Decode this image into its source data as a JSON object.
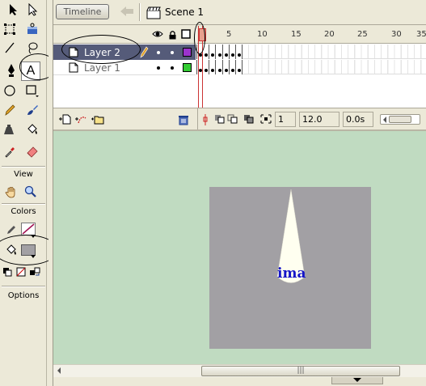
{
  "tools_panel": {
    "tools": [
      {
        "name": "arrow-tool-icon"
      },
      {
        "name": "subselect-tool-icon"
      },
      {
        "name": "free-transform-tool-icon"
      },
      {
        "name": "fill-transform-tool-icon"
      },
      {
        "name": "line-tool-icon"
      },
      {
        "name": "lasso-tool-icon"
      },
      {
        "name": "pen-tool-icon"
      },
      {
        "name": "text-tool-icon",
        "glyph": "A",
        "selected": true
      },
      {
        "name": "oval-tool-icon"
      },
      {
        "name": "rectangle-tool-icon"
      },
      {
        "name": "pencil-tool-icon"
      },
      {
        "name": "brush-tool-icon"
      },
      {
        "name": "ink-bottle-tool-icon"
      },
      {
        "name": "paint-bucket-tool-icon"
      },
      {
        "name": "eyedropper-tool-icon"
      },
      {
        "name": "eraser-tool-icon"
      }
    ],
    "view_label": "View",
    "colors_label": "Colors",
    "options_label": "Options",
    "stroke_color": "#A01050",
    "fill_color": "#A2A0A4"
  },
  "topbar": {
    "timeline_button": "Timeline",
    "scene_label": "Scene 1"
  },
  "timeline": {
    "ruler_numbers": [
      "1",
      "5",
      "10",
      "15",
      "20",
      "25",
      "30",
      "35"
    ],
    "layers": [
      {
        "label": "Layer 2",
        "selected": true,
        "color": "#9B33CC"
      },
      {
        "label": "Layer 1",
        "selected": false,
        "color": "#33CC33"
      }
    ],
    "footer": {
      "current_frame": "1",
      "frame_rate": "12.0 fps",
      "elapsed_time": "0.0s"
    }
  },
  "stage": {
    "text": "ima",
    "background": "#A2A0A4",
    "work_area": "#C0DBC1",
    "text_color": "#1515C8"
  },
  "scrollbar": {
    "thumb_grip": "|||"
  }
}
